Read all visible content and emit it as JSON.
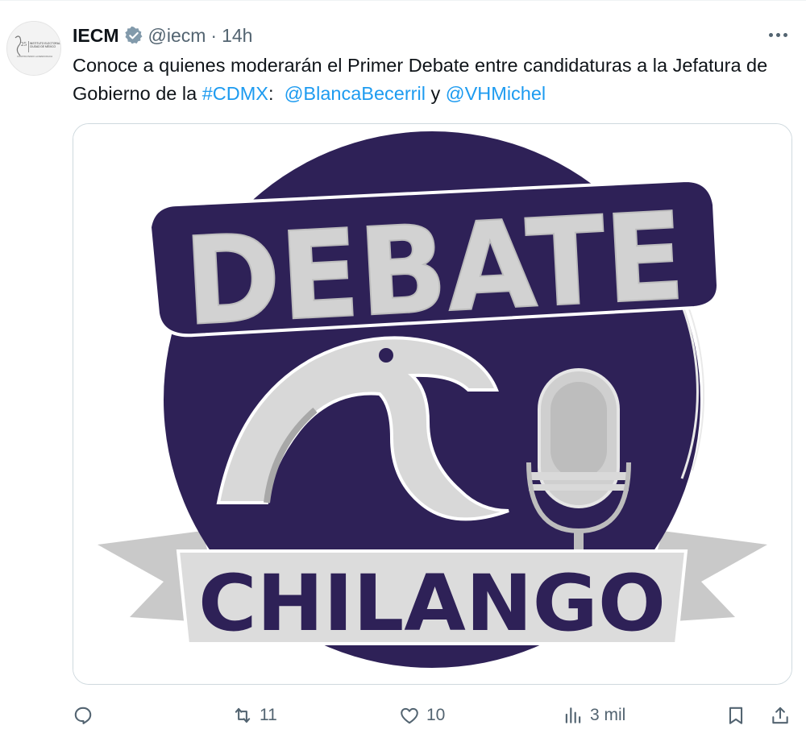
{
  "tweet": {
    "author_name": "IECM",
    "handle": "@iecm",
    "separator": "·",
    "time": "14h",
    "text_part1": "Conoce a quienes moderarán el Primer Debate entre candidaturas a la Jefatura de Gobierno de la ",
    "hashtag": "#CDMX",
    "text_part2": ":  ",
    "mention1": "@BlancaBecerril",
    "text_part3": " y ",
    "mention2": "@VHMichel"
  },
  "avatar_logo": {
    "badge": "25",
    "line1": "INSTITUTO ELECTORAL",
    "line2": "CIUDAD DE MÉXICO",
    "line3": "CONSTRUYENDO LA DEMOCRACIA"
  },
  "media": {
    "logo_top_text": "DEBATE",
    "logo_bottom_text": "CHILANGO",
    "colors": {
      "purple": "#2e2157",
      "silver": "#c9c9c9",
      "light": "#e6e6e6"
    }
  },
  "actions": {
    "reply_count": "",
    "retweet_count": "11",
    "like_count": "10",
    "views_count": "3 mil"
  },
  "icons": {
    "verified": "verified-badge-icon",
    "more": "more-options-icon",
    "reply": "reply-icon",
    "retweet": "retweet-icon",
    "like": "heart-icon",
    "views": "views-chart-icon",
    "bookmark": "bookmark-icon",
    "share": "share-icon"
  },
  "colors": {
    "link": "#1d9bf0",
    "secondary_text": "#536471",
    "primary_text": "#0f1419"
  }
}
